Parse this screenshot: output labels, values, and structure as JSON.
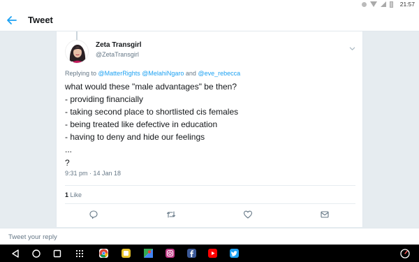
{
  "status_bar": {
    "battery_pct": "",
    "time": "21:57"
  },
  "header": {
    "title": "Tweet"
  },
  "tweet": {
    "display_name": "Zeta Transgirl",
    "handle": "@ZetaTransgirl",
    "replying_prefix": "Replying to",
    "reply_to": [
      "@MatterRights",
      "@MelahiNgaro"
    ],
    "reply_conjunction": "and",
    "reply_last": "@eve_rebecca",
    "text_lines": [
      "what would these \"male advantages\" be then?",
      "- providing financially",
      "- taking second place to shortlisted cis females",
      "- being treated like defective in education",
      "- having to deny and hide our feelings",
      "...",
      "?"
    ],
    "timestamp": "9:31 pm · 14 Jan 18",
    "like_count": "1",
    "like_label": "Like"
  },
  "reply_bar": {
    "placeholder": "Tweet your reply"
  },
  "icons": {
    "back": "arrow-left",
    "caret": "chevron-down",
    "reply": "speech-bubble",
    "retweet": "retweet-arrows",
    "like": "heart",
    "dm": "envelope"
  },
  "apps": [
    {
      "name": "chrome",
      "color": "#db4437"
    },
    {
      "name": "notes",
      "color": "#e8c32a"
    },
    {
      "name": "maps",
      "color": "#34a853"
    },
    {
      "name": "instagram",
      "color": "#c13584"
    },
    {
      "name": "facebook",
      "color": "#3b5998"
    },
    {
      "name": "youtube",
      "color": "#ff0000"
    },
    {
      "name": "twitter",
      "color": "#1da1f2"
    }
  ],
  "colors": {
    "accent": "#1da1f2",
    "background": "#e6ecf0",
    "text_secondary": "#657786"
  }
}
